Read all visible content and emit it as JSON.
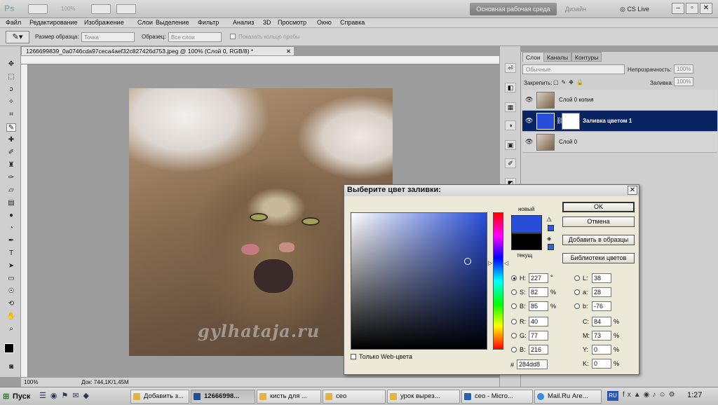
{
  "appbar": {
    "logo": "Ps",
    "zoom": "100%",
    "workspace": "Основная рабочая среда",
    "design": "Дизайн",
    "cslive": "CS Live"
  },
  "menu": [
    "Файл",
    "Редактирование",
    "Изображение",
    "Слои",
    "Выделение",
    "Фильтр",
    "Анализ",
    "3D",
    "Просмотр",
    "Окно",
    "Справка"
  ],
  "options": {
    "sample_size_label": "Размер образца:",
    "sample_size_value": "Точка",
    "sample_label": "Образец:",
    "sample_value": "Все слои",
    "ring_label": "Показать кольцо пробы"
  },
  "document": {
    "tab": "1266699839_0a0746cda97ceca4aef32c827426d753.jpeg @ 100% (Слой 0, RGB/8) *",
    "watermark": "gylhataja.ru",
    "status_zoom": "100%",
    "status_doc": "Док: 744,1K/1,45M"
  },
  "layers_panel": {
    "tabs": [
      "Слои",
      "Каналы",
      "Контуры"
    ],
    "blend_mode": "Обычные",
    "opacity_label": "Непрозрачность:",
    "opacity_value": "100%",
    "lock_label": "Закрепить:",
    "fill_label": "Заливка:",
    "fill_value": "100%",
    "layers": [
      {
        "name": "Слой 0 копия",
        "selected": false
      },
      {
        "name": "Заливка цветом 1",
        "selected": true
      },
      {
        "name": "Слой 0",
        "selected": false
      }
    ]
  },
  "dialog": {
    "title": "Выберите цвет заливки:",
    "new_label": "новый",
    "current_label": "текущ",
    "new_color": "#284dd8",
    "current_color": "#000000",
    "buttons": {
      "ok": "OK",
      "cancel": "Отмена",
      "add": "Добавить в образцы",
      "libraries": "Библиотеки цветов"
    },
    "hsb": {
      "h": "227",
      "h_unit": "°",
      "s": "82",
      "s_unit": "%",
      "b": "85",
      "b_unit": "%"
    },
    "rgb": {
      "r": "40",
      "g": "77",
      "b": "216"
    },
    "lab": {
      "l": "38",
      "a": "28",
      "b": "-76"
    },
    "cmyk": {
      "c": "84",
      "m": "73",
      "y": "0",
      "k": "0",
      "unit": "%"
    },
    "labels": {
      "h": "H:",
      "s": "S:",
      "b": "B:",
      "r": "R:",
      "g": "G:",
      "bb": "B:",
      "l": "L:",
      "a": "a:",
      "lb": "b:",
      "c": "C:",
      "m": "M:",
      "y": "Y:",
      "k": "K:",
      "hash": "#"
    },
    "hex": "284dd8",
    "web_only": "Только Web-цвета"
  },
  "taskbar": {
    "start": "Пуск",
    "tasks": [
      "Добавить з...",
      "12666998...",
      "кисть для ...",
      "сео",
      "урок вырез...",
      "сео - Micro...",
      "Mail.Ru Аге..."
    ],
    "lang": "RU",
    "clock": "1:27"
  }
}
